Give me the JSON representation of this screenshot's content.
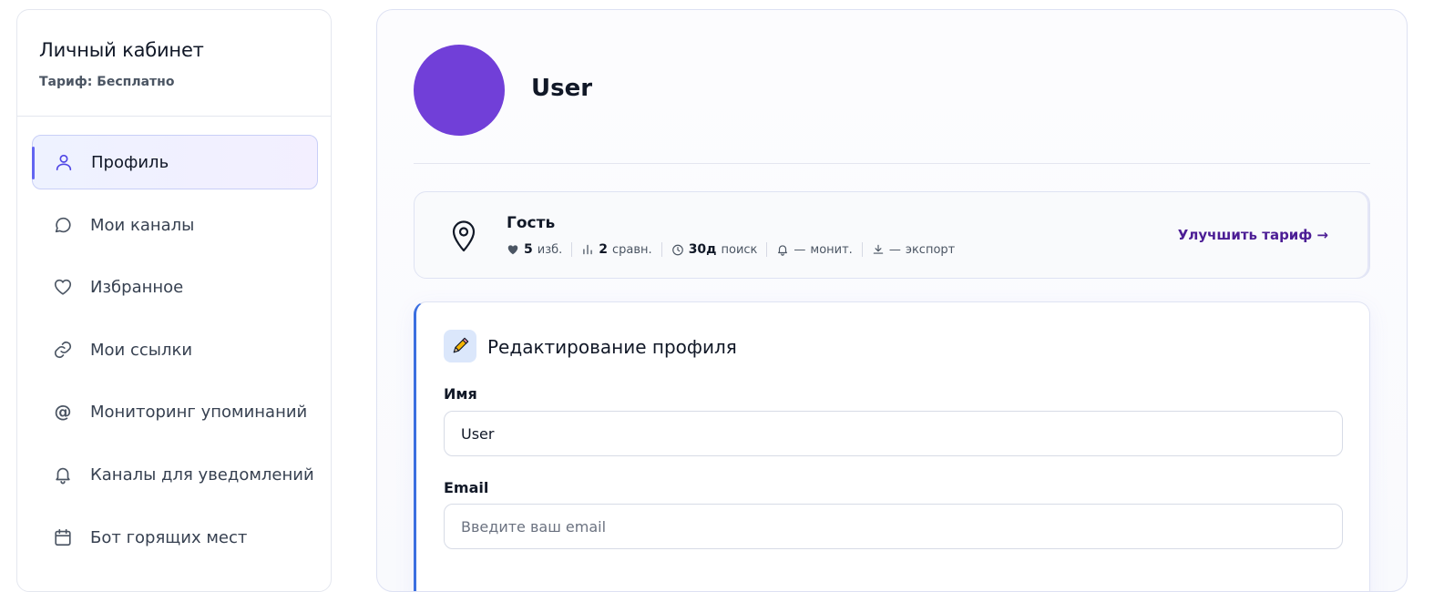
{
  "sidebar": {
    "title": "Личный кабинет",
    "plan": "Тариф: Бесплатно",
    "items": [
      {
        "label": "Профиль",
        "icon": "user-icon",
        "active": true
      },
      {
        "label": "Мои каналы",
        "icon": "chat-bubble-icon"
      },
      {
        "label": "Избранное",
        "icon": "heart-icon"
      },
      {
        "label": "Мои ссылки",
        "icon": "link-icon"
      },
      {
        "label": "Мониторинг упоминаний",
        "icon": "at-sign-icon"
      },
      {
        "label": "Каналы для уведомлений",
        "icon": "bell-icon"
      },
      {
        "label": "Бот горящих мест",
        "icon": "calendar-icon"
      }
    ]
  },
  "profile": {
    "username": "User",
    "avatar_color": "#713fd8"
  },
  "status": {
    "role": "Гость",
    "stats": [
      {
        "icon": "heart-filled-icon",
        "value": "5",
        "label": "изб."
      },
      {
        "icon": "bar-chart-icon",
        "value": "2",
        "label": "сравн."
      },
      {
        "icon": "clock-icon",
        "value": "30д",
        "label": "поиск"
      },
      {
        "icon": "bell-icon",
        "value": "—",
        "label": "монит."
      },
      {
        "icon": "download-icon",
        "value": "—",
        "label": "экспорт"
      }
    ],
    "upgrade_label": "Улучшить тариф →"
  },
  "edit": {
    "title": "Редактирование профиля",
    "name_label": "Имя",
    "name_value": "User",
    "email_label": "Email",
    "email_placeholder": "Введите ваш email"
  },
  "colors": {
    "accent": "#6366f1",
    "edit_border": "#3b6fe0",
    "upgrade": "#4c1d95"
  }
}
